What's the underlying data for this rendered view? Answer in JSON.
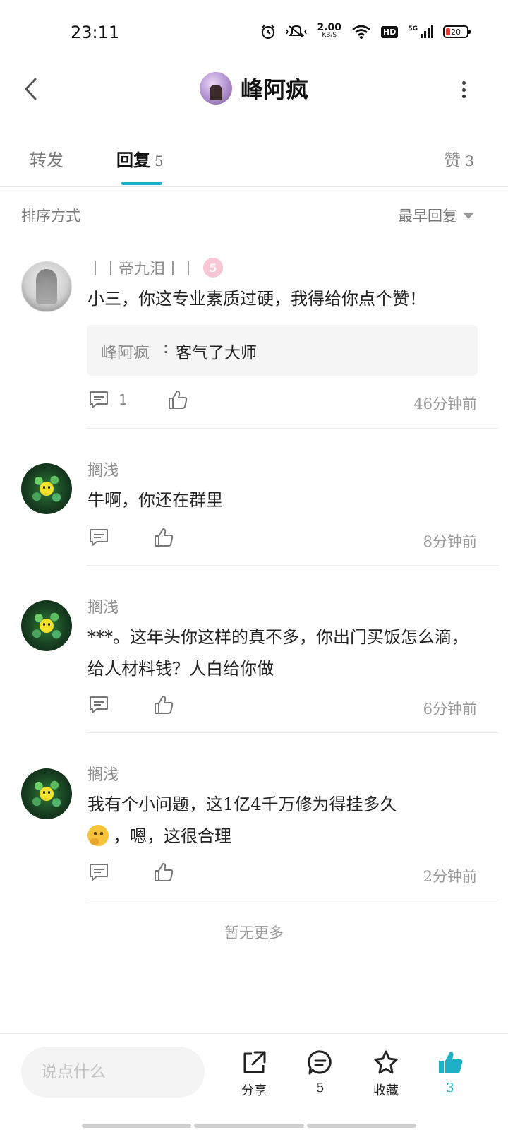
{
  "status_bar": {
    "time": "23:11",
    "net_speed_value": "2.00",
    "net_speed_unit": "KB/S",
    "hd": "HD",
    "signal_label": "5G",
    "battery": "20"
  },
  "header": {
    "title": "峰阿疯"
  },
  "tabs": {
    "forward_label": "转发",
    "reply_label": "回复",
    "reply_count": "5",
    "like_label": "赞",
    "like_count": "3"
  },
  "sort": {
    "label": "排序方式",
    "selected": "最早回复"
  },
  "comments": [
    {
      "name": "丨丨帝九泪丨丨",
      "badge": "5",
      "text": "小三，你这专业素质过硬，我得给你点个赞！",
      "quote_author": "峰阿疯",
      "quote_sep": ":",
      "quote_text": "客气了大师",
      "reply_count": "1",
      "time": "46分钟前"
    },
    {
      "name": "搁浅",
      "text": "牛啊，你还在群里",
      "time": "8分钟前"
    },
    {
      "name": "搁浅",
      "text": "***。这年头你这样的真不多，你出门买饭怎么滴，给人材料钱？人白给你做",
      "time": "6分钟前"
    },
    {
      "name": "搁浅",
      "text_line1": "我有个小问题，这1亿4千万修为得挂多久",
      "text_line2": "，嗯，这很合理",
      "time": "2分钟前"
    }
  ],
  "footer_note": "暂无更多",
  "bottom_bar": {
    "input_placeholder": "说点什么",
    "share_label": "分享",
    "comment_count": "5",
    "favorite_label": "收藏",
    "like_count": "3"
  },
  "colors": {
    "accent": "#19b0c8",
    "battery_low": "#e53935"
  }
}
